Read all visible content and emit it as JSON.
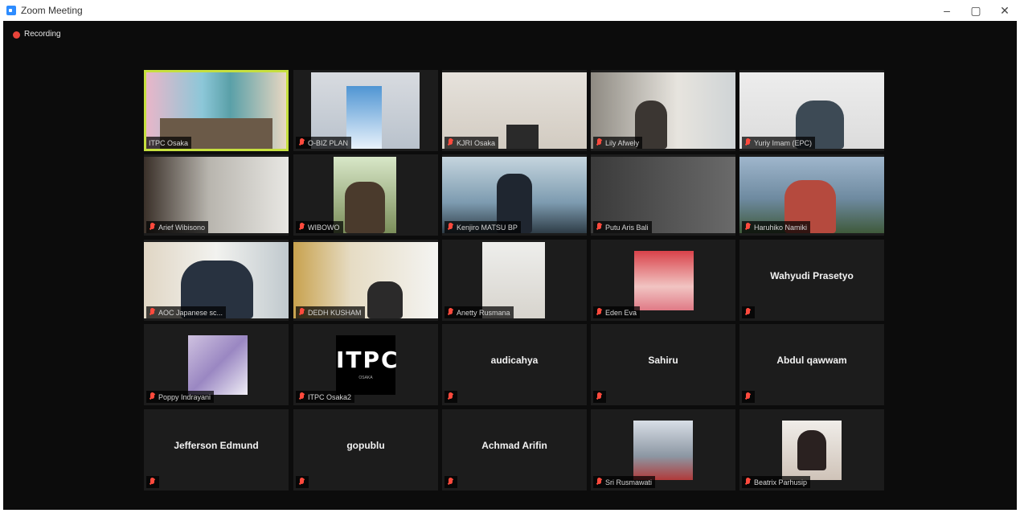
{
  "window": {
    "title": "Zoom Meeting",
    "minimize_glyph": "–",
    "maximize_glyph": "▢",
    "close_glyph": "✕"
  },
  "recording": {
    "label": "Recording"
  },
  "participants": [
    {
      "name": "ITPC Osaka",
      "has_video": true,
      "active_speaker": true,
      "muted": false
    },
    {
      "name": "O-BIZ PLAN",
      "has_video": true,
      "muted": true
    },
    {
      "name": "KJRI Osaka",
      "has_video": true,
      "muted": true
    },
    {
      "name": "Lily Afwely",
      "has_video": true,
      "muted": true
    },
    {
      "name": "Yuriy Imam (EPC)",
      "has_video": true,
      "muted": true
    },
    {
      "name": "Arief Wibisono",
      "has_video": true,
      "muted": true
    },
    {
      "name": "WIBOWO",
      "has_video": true,
      "muted": true
    },
    {
      "name": "Kenjiro MATSU BP",
      "has_video": true,
      "muted": true
    },
    {
      "name": "Putu Aris Bali",
      "has_video": true,
      "muted": true
    },
    {
      "name": "Haruhiko Namiki",
      "has_video": true,
      "muted": true
    },
    {
      "name": "AOC Japanese sc...",
      "has_video": true,
      "muted": true
    },
    {
      "name": "DEDH KUSHAM",
      "has_video": true,
      "muted": true
    },
    {
      "name": "Anetty Rusmana",
      "has_video": true,
      "muted": true
    },
    {
      "name": "Eden Eva",
      "has_video": true,
      "muted": true
    },
    {
      "name": "Wahyudi Prasetyo",
      "has_video": false,
      "muted": true
    },
    {
      "name": "Poppy Indrayani",
      "has_video": true,
      "muted": true
    },
    {
      "name": "ITPC Osaka2",
      "has_video": true,
      "muted": true,
      "logo": "ITPC",
      "logo_sub": "OSAKA"
    },
    {
      "name": "audicahya",
      "has_video": false,
      "muted": true
    },
    {
      "name": "Sahiru",
      "has_video": false,
      "muted": true
    },
    {
      "name": "Abdul qawwam",
      "has_video": false,
      "muted": true
    },
    {
      "name": "Jefferson Edmund",
      "has_video": false,
      "muted": true
    },
    {
      "name": "gopublu",
      "has_video": false,
      "muted": true
    },
    {
      "name": "Achmad Arifin",
      "has_video": false,
      "muted": true
    },
    {
      "name": "Sri Rusmawati",
      "has_video": true,
      "muted": true
    },
    {
      "name": "Beatrix Parhusip",
      "has_video": true,
      "muted": true
    }
  ],
  "colors": {
    "meeting_bg": "#0c0c0c",
    "tile_bg": "#1c1c1c",
    "active_speaker_border": "#c6df3f",
    "muted_icon": "#ff4a3d",
    "recording_dot": "#e8443a"
  }
}
